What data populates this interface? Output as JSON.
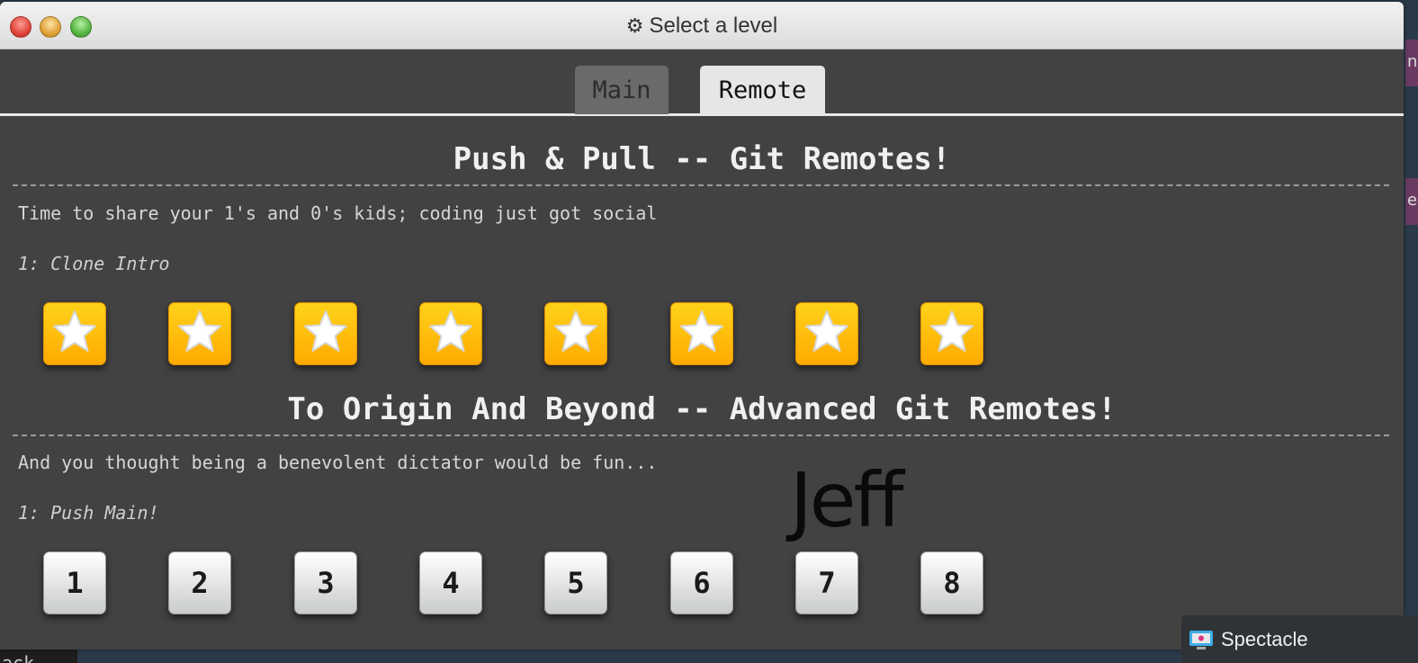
{
  "window": {
    "title": "Select a level",
    "title_icon": "gear-icon"
  },
  "tabs": [
    {
      "label": "Main",
      "selected": false
    },
    {
      "label": "Remote",
      "selected": true
    }
  ],
  "sections": [
    {
      "title": "Push & Pull -- Git Remotes!",
      "description": "Time to share your 1's and 0's kids; coding just got social",
      "current_level": "1: Clone Intro",
      "levels": [
        "★",
        "★",
        "★",
        "★",
        "★",
        "★",
        "★",
        "★"
      ],
      "levels_completed": [
        true,
        true,
        true,
        true,
        true,
        true,
        true,
        true
      ]
    },
    {
      "title": "To Origin And Beyond -- Advanced Git Remotes!",
      "description": "And you thought being a benevolent dictator would be fun...",
      "current_level": "1: Push Main!",
      "levels": [
        "1",
        "2",
        "3",
        "4",
        "5",
        "6",
        "7",
        "8"
      ],
      "levels_completed": [
        false,
        false,
        false,
        false,
        false,
        false,
        false,
        false
      ]
    }
  ],
  "overlay_text": "Jeff",
  "taskbar": {
    "spectacle_label": "Spectacle"
  },
  "background": {
    "corner_text": "ack",
    "right_tab1": "n",
    "right_tab2": "e"
  },
  "colors": {
    "window_bg": "#424242",
    "star_button": "#ffc000",
    "tab_selected": "#e6e6e6"
  }
}
